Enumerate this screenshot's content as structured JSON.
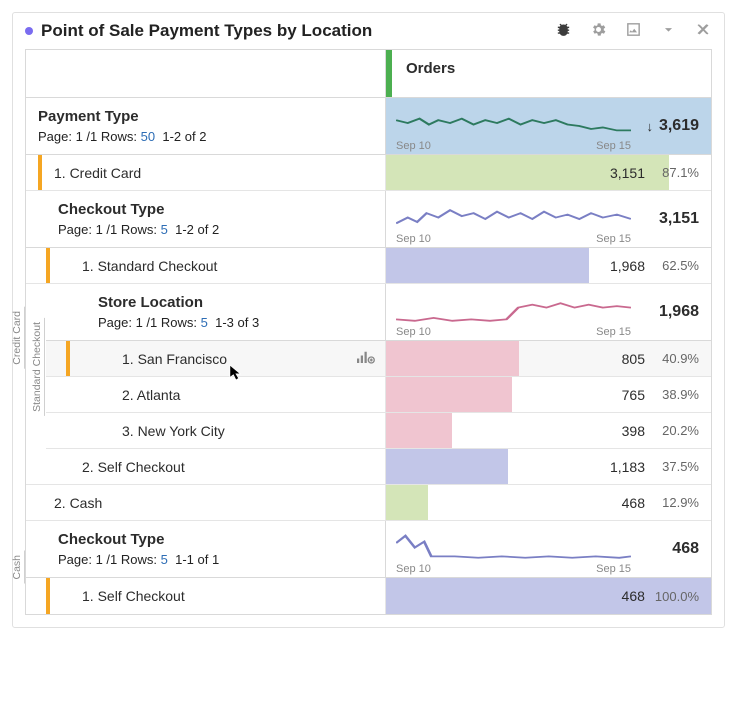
{
  "panel": {
    "title": "Point of Sale Payment Types by Location"
  },
  "metric": {
    "name": "Orders",
    "total": "3,619",
    "trendStart": "Sep 10",
    "trendEnd": "Sep 15"
  },
  "paymentType": {
    "title": "Payment Type",
    "pageLabel": "Page: 1 /1  Rows:",
    "rowsLink": "50",
    "rangeLabel": "1-2 of 2",
    "rows": [
      {
        "label": "1. Credit Card",
        "value": "3,151",
        "pct": "87.1%",
        "barPct": 87.1
      },
      {
        "label": "2. Cash",
        "value": "468",
        "pct": "12.9%",
        "barPct": 12.9
      }
    ]
  },
  "checkoutType_credit": {
    "title": "Checkout Type",
    "pageLabel": "Page: 1 /1  Rows:",
    "rowsLink": "5",
    "rangeLabel": "1-2 of 2",
    "total": "3,151",
    "trendStart": "Sep 10",
    "trendEnd": "Sep 15",
    "rows": [
      {
        "label": "1. Standard Checkout",
        "value": "1,968",
        "pct": "62.5%",
        "barPct": 62.5
      },
      {
        "label": "2. Self Checkout",
        "value": "1,183",
        "pct": "37.5%",
        "barPct": 37.5
      }
    ]
  },
  "storeLocation": {
    "title": "Store Location",
    "pageLabel": "Page: 1 /1  Rows:",
    "rowsLink": "5",
    "rangeLabel": "1-3 of 3",
    "total": "1,968",
    "trendStart": "Sep 10",
    "trendEnd": "Sep 15",
    "rows": [
      {
        "label": "1. San Francisco",
        "value": "805",
        "pct": "40.9%",
        "barPct": 40.9
      },
      {
        "label": "2. Atlanta",
        "value": "765",
        "pct": "38.9%",
        "barPct": 38.9
      },
      {
        "label": "3. New York City",
        "value": "398",
        "pct": "20.2%",
        "barPct": 20.2
      }
    ]
  },
  "checkoutType_cash": {
    "title": "Checkout Type",
    "pageLabel": "Page: 1 /1  Rows:",
    "rowsLink": "5",
    "rangeLabel": "1-1 of 1",
    "total": "468",
    "trendStart": "Sep 10",
    "trendEnd": "Sep 15",
    "rows": [
      {
        "label": "1. Self Checkout",
        "value": "468",
        "pct": "100.0%",
        "barPct": 100.0
      }
    ]
  },
  "sideLabels": {
    "creditCard": "Credit Card",
    "standardCheckout": "Standard Checkout",
    "cash": "Cash"
  },
  "colors": {
    "paymentBar": "#d4e5b8",
    "checkoutBar": "#c2c6e8",
    "locationBar": "#f0c5d0",
    "metricBg": "#bcd5ea"
  }
}
